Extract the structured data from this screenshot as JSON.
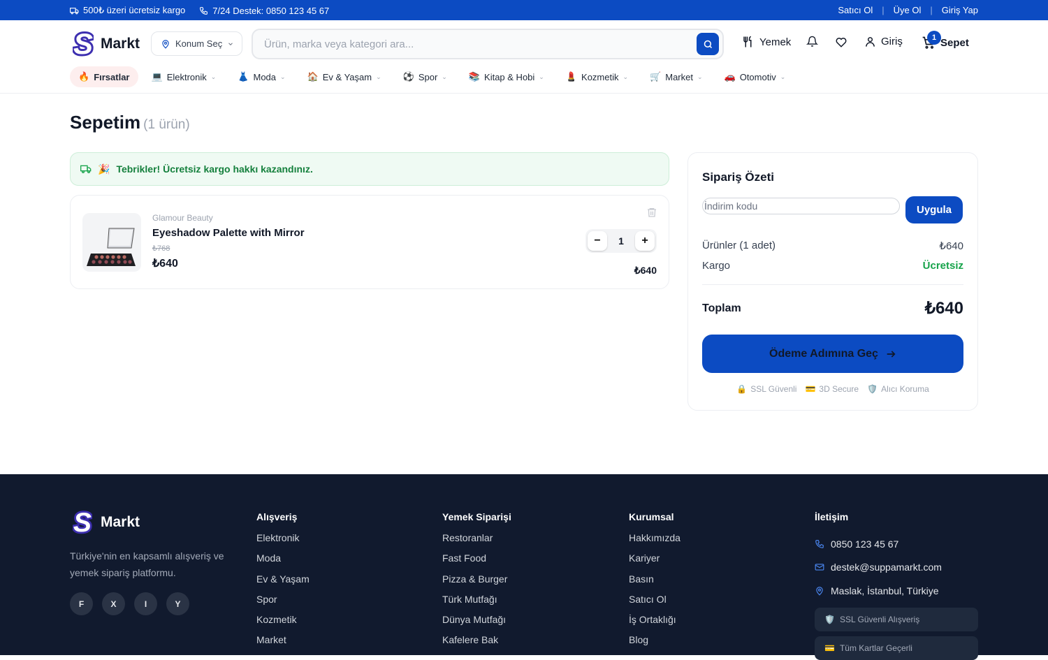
{
  "topbar": {
    "shipping": "500₺ üzeri ücretsiz kargo",
    "support": "7/24 Destek: 0850 123 45 67",
    "links": [
      "Satıcı Ol",
      "Üye Ol",
      "Giriş Yap"
    ]
  },
  "header": {
    "brand": "Markt",
    "location": "Konum Seç",
    "search_placeholder": "Ürün, marka veya kategori ara...",
    "food": "Yemek",
    "login": "Giriş",
    "cart": "Sepet",
    "cart_count": "1"
  },
  "nav": [
    {
      "icon": "🔥",
      "label": "Fırsatlar"
    },
    {
      "icon": "💻",
      "label": "Elektronik"
    },
    {
      "icon": "👗",
      "label": "Moda"
    },
    {
      "icon": "🏠",
      "label": "Ev & Yaşam"
    },
    {
      "icon": "⚽",
      "label": "Spor"
    },
    {
      "icon": "📚",
      "label": "Kitap & Hobi"
    },
    {
      "icon": "💄",
      "label": "Kozmetik"
    },
    {
      "icon": "🛒",
      "label": "Market"
    },
    {
      "icon": "🚗",
      "label": "Otomotiv"
    }
  ],
  "page": {
    "title": "Sepetim",
    "count": "(1 ürün)",
    "notice": "Tebrikler! Ücretsiz kargo hakkı kazandınız."
  },
  "cart_item": {
    "brand": "Glamour Beauty",
    "name": "Eyeshadow Palette with Mirror",
    "old_price": "₺768",
    "price": "₺640",
    "quantity": "1",
    "line_total": "₺640"
  },
  "summary": {
    "title": "Sipariş Özeti",
    "coupon_placeholder": "İndirim kodu",
    "apply": "Uygula",
    "items_label": "Ürünler (1 adet)",
    "items_value": "₺640",
    "shipping_label": "Kargo",
    "shipping_value": "Ücretsiz",
    "total_label": "Toplam",
    "total_value": "₺640",
    "checkout": "Ödeme Adımına Geç",
    "trust": [
      {
        "icon": "🔒",
        "label": "SSL Güvenli"
      },
      {
        "icon": "💳",
        "label": "3D Secure"
      },
      {
        "icon": "🛡️",
        "label": "Alıcı Koruma"
      }
    ]
  },
  "footer": {
    "brand": "Markt",
    "description": "Türkiye'nin en kapsamlı alışveriş ve yemek sipariş platformu.",
    "social": [
      "F",
      "X",
      "I",
      "Y"
    ],
    "columns": [
      {
        "title": "Alışveriş",
        "links": [
          "Elektronik",
          "Moda",
          "Ev & Yaşam",
          "Spor",
          "Kozmetik",
          "Market"
        ]
      },
      {
        "title": "Yemek Siparişi",
        "links": [
          "Restoranlar",
          "Fast Food",
          "Pizza & Burger",
          "Türk Mutfağı",
          "Dünya Mutfağı",
          "Kafelere Bak"
        ]
      },
      {
        "title": "Kurumsal",
        "links": [
          "Hakkımızda",
          "Kariyer",
          "Basın",
          "Satıcı Ol",
          "İş Ortaklığı",
          "Blog"
        ]
      }
    ],
    "contact": {
      "title": "İletişim",
      "phone": "0850 123 45 67",
      "email": "destek@suppamarkt.com",
      "address": "Maslak, İstanbul, Türkiye",
      "badges": [
        {
          "icon": "🛡️",
          "label": "SSL Güvenli Alışveriş"
        },
        {
          "icon": "💳",
          "label": "Tüm Kartlar Geçerli"
        }
      ]
    }
  },
  "colors": {
    "primary": "#0c4bc2",
    "success": "#16a34a",
    "footer": "#111a2e"
  }
}
